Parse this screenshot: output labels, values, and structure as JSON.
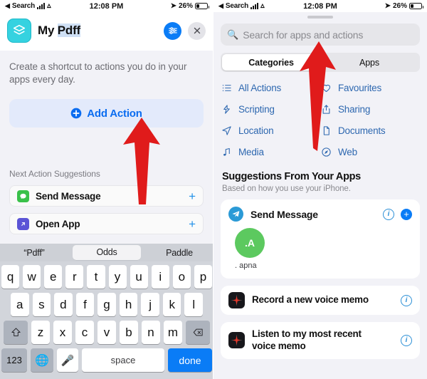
{
  "status_bar": {
    "back_label": "Search",
    "back_glyph": "◀",
    "wifi_glyph": "▾",
    "time": "12:08 PM",
    "location_glyph": "➤",
    "battery": "26%"
  },
  "left_screen": {
    "header": {
      "app_icon_name": "shortcuts-app-icon",
      "title_prefix": "My ",
      "title_selected": "Pdff",
      "settings_button": "shortcut-settings",
      "close_button": "close"
    },
    "description": "Create a shortcut to actions you do in your apps every day.",
    "add_action_label": "Add Action",
    "next_action_heading": "Next Action Suggestions",
    "suggestions": [
      {
        "label": "Send Message",
        "icon": "messages-icon",
        "icon_color": "#3ac14a",
        "add_glyph": "+"
      },
      {
        "label": "Open App",
        "icon": "open-app-icon",
        "icon_color": "#5b54d6",
        "add_glyph": "+"
      }
    ],
    "keyboard": {
      "predictions": [
        "“Pdff”",
        "Odds",
        "Paddle"
      ],
      "selected_prediction": "Odds",
      "row1": [
        "q",
        "w",
        "e",
        "r",
        "t",
        "y",
        "u",
        "i",
        "o",
        "p"
      ],
      "row2": [
        "a",
        "s",
        "d",
        "f",
        "g",
        "h",
        "j",
        "k",
        "l"
      ],
      "row3": [
        "z",
        "x",
        "c",
        "v",
        "b",
        "n",
        "m"
      ],
      "shift_key": "shift",
      "backspace_key": "backspace",
      "numbers_key": "123",
      "globe_key": "globe",
      "mic_key": "microphone",
      "space_key": "space",
      "return_key": "done"
    }
  },
  "right_screen": {
    "search_placeholder": "Search for apps and actions",
    "search_value": "",
    "segments": [
      {
        "label": "Categories",
        "active": true
      },
      {
        "label": "Apps",
        "active": false
      }
    ],
    "categories": [
      {
        "label": "All Actions",
        "icon": "list-icon"
      },
      {
        "label": "Favourites",
        "icon": "heart-icon"
      },
      {
        "label": "Scripting",
        "icon": "scripting-icon"
      },
      {
        "label": "Sharing",
        "icon": "share-icon"
      },
      {
        "label": "Location",
        "icon": "location-arrow-icon"
      },
      {
        "label": "Documents",
        "icon": "document-icon"
      },
      {
        "label": "Media",
        "icon": "music-note-icon"
      },
      {
        "label": "Web",
        "icon": "compass-icon"
      }
    ],
    "suggestions_heading": "Suggestions From Your Apps",
    "suggestions_subheading": "Based on how you use your iPhone.",
    "telegram_card": {
      "title": "Send Message",
      "app_icon": "telegram-icon",
      "info_glyph": "i",
      "add_glyph": "+",
      "contact_initials": ".A",
      "contact_name": ". apna",
      "avatar_color": "#5cc95f"
    },
    "action_rows": [
      {
        "title": "Record a new voice memo",
        "icon": "voice-memos-icon",
        "info_glyph": "i"
      },
      {
        "title": "Listen to my most recent voice memo",
        "icon": "voice-memos-icon",
        "info_glyph": "i"
      }
    ]
  },
  "annotations": {
    "arrow_color": "#e01b1b",
    "left_arrow_name": "red-arrow-pointing-to-add-action",
    "right_arrow_name": "red-arrow-pointing-to-search-field"
  }
}
